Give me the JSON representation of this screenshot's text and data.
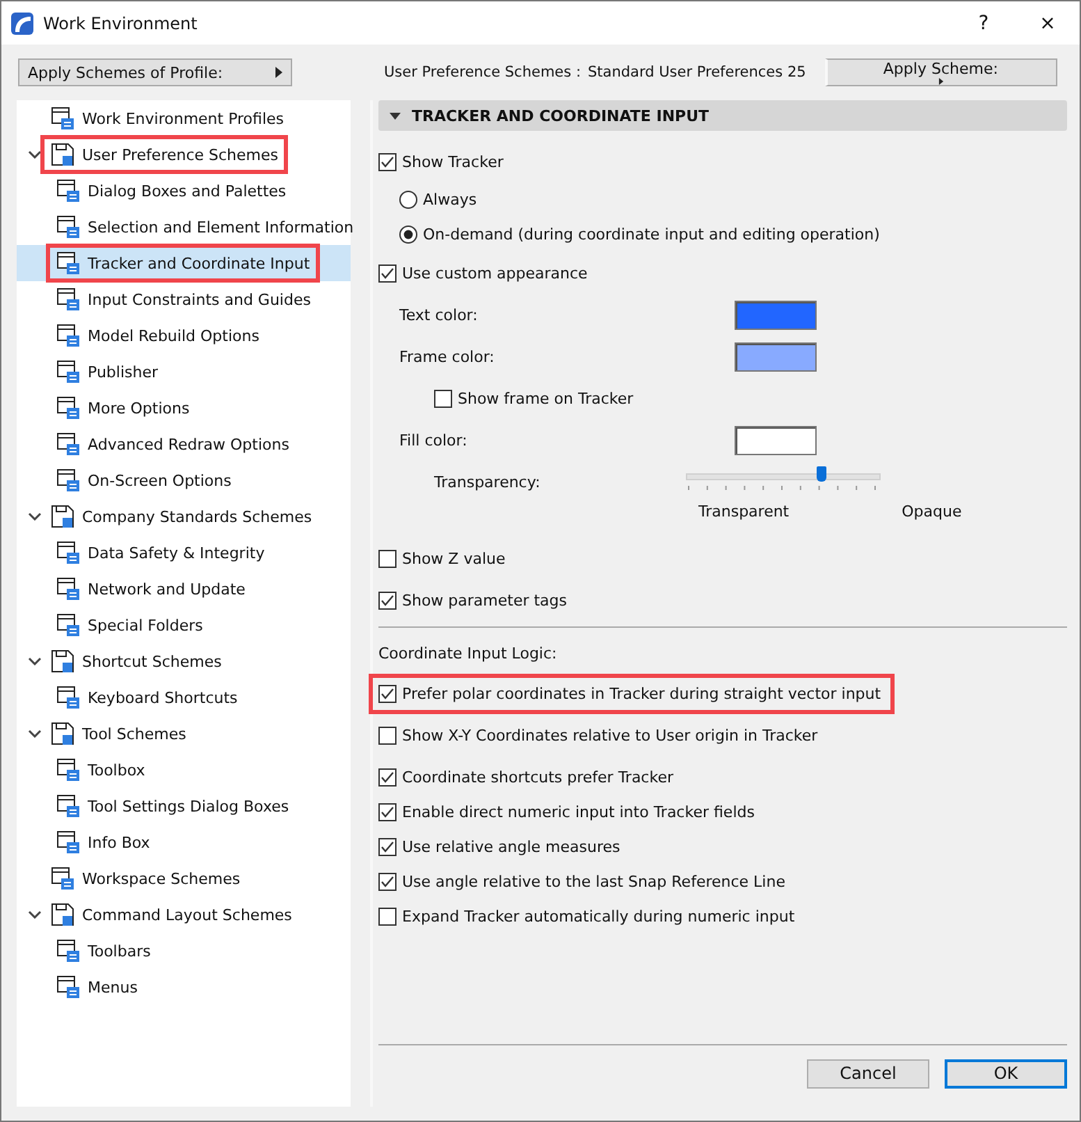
{
  "window": {
    "title": "Work Environment",
    "buttons": [
      "?",
      "×"
    ]
  },
  "profile_menu": {
    "label": "Apply Schemes of Profile:"
  },
  "scheme_info": {
    "label": "User Preference Schemes :",
    "value": "Standard User Preferences 25"
  },
  "apply_scheme_menu": {
    "label": "Apply Scheme:"
  },
  "tree": [
    {
      "label": "Work Environment Profiles",
      "selected": false,
      "annotated": false
    },
    {
      "label": "User Preference Schemes",
      "selected": false,
      "annotated": true,
      "expanded": true,
      "children": [
        {
          "label": "Dialog Boxes and Palettes",
          "selected": false,
          "annotated": false
        },
        {
          "label": "Selection and Element Information",
          "selected": false,
          "annotated": false
        },
        {
          "label": "Tracker and Coordinate Input",
          "selected": true,
          "annotated": true
        },
        {
          "label": "Input Constraints and Guides",
          "selected": false,
          "annotated": false
        },
        {
          "label": "Model Rebuild Options",
          "selected": false,
          "annotated": false
        },
        {
          "label": "Publisher",
          "selected": false,
          "annotated": false
        },
        {
          "label": "More Options",
          "selected": false,
          "annotated": false
        },
        {
          "label": "Advanced Redraw Options",
          "selected": false,
          "annotated": false
        },
        {
          "label": "On-Screen Options",
          "selected": false,
          "annotated": false
        }
      ]
    },
    {
      "label": "Company Standards Schemes",
      "selected": false,
      "annotated": false,
      "expanded": true,
      "children": [
        {
          "label": "Data Safety & Integrity",
          "selected": false,
          "annotated": false
        },
        {
          "label": "Network and Update",
          "selected": false,
          "annotated": false
        },
        {
          "label": "Special Folders",
          "selected": false,
          "annotated": false
        }
      ]
    },
    {
      "label": "Shortcut Schemes",
      "selected": false,
      "annotated": false,
      "expanded": true,
      "children": [
        {
          "label": "Keyboard Shortcuts",
          "selected": false,
          "annotated": false
        }
      ]
    },
    {
      "label": "Tool Schemes",
      "selected": false,
      "annotated": false,
      "expanded": true,
      "children": [
        {
          "label": "Toolbox",
          "selected": false,
          "annotated": false
        },
        {
          "label": "Tool Settings Dialog Boxes",
          "selected": false,
          "annotated": false
        },
        {
          "label": "Info Box",
          "selected": false,
          "annotated": false
        }
      ]
    },
    {
      "label": "Workspace Schemes",
      "selected": false,
      "annotated": false
    },
    {
      "label": "Command Layout Schemes",
      "selected": false,
      "annotated": false,
      "expanded": true,
      "children": [
        {
          "label": "Toolbars",
          "selected": false,
          "annotated": false
        },
        {
          "label": "Menus",
          "selected": false,
          "annotated": false
        }
      ]
    }
  ],
  "panel": {
    "title": "TRACKER AND COORDINATE INPUT",
    "expanded": true,
    "sections": [
      {
        "items": [
          {
            "kind": "checkbox",
            "label": "Show Tracker",
            "checked": true,
            "annotated": false,
            "children": [
              {
                "kind": "radio",
                "label": "Always",
                "selected": false
              },
              {
                "kind": "radio",
                "label": "On-demand (during coordinate input and editing operation)",
                "selected": true
              }
            ]
          },
          {
            "kind": "checkbox",
            "label": "Use custom appearance",
            "checked": true,
            "annotated": false,
            "children": [
              {
                "kind": "color",
                "label": "Text color:",
                "color": "#2266ff"
              },
              {
                "kind": "color",
                "label": "Frame color:",
                "color": "#88aaff",
                "children": [
                  {
                    "kind": "checkbox",
                    "label": "Show frame on Tracker",
                    "checked": false,
                    "annotated": false
                  }
                ]
              },
              {
                "kind": "color",
                "label": "Fill color:",
                "color": "#ffffff",
                "children": [
                  {
                    "kind": "slider",
                    "label": "Transparency:",
                    "level": 0.7,
                    "min_label": "Transparent",
                    "max_label": "Opaque"
                  }
                ]
              }
            ]
          },
          {
            "kind": "checkbox",
            "label": "Show Z value",
            "checked": false,
            "annotated": false
          },
          {
            "kind": "checkbox",
            "label": "Show parameter tags",
            "checked": true,
            "annotated": false
          }
        ]
      },
      {
        "heading": "Coordinate Input Logic:",
        "items": [
          {
            "kind": "checkbox",
            "label": "Prefer polar coordinates in Tracker during straight vector input",
            "checked": true,
            "annotated": true
          },
          {
            "kind": "checkbox",
            "label": "Show X-Y Coordinates relative to User origin in Tracker",
            "checked": false,
            "annotated": false
          }
        ]
      },
      {
        "items": [
          {
            "kind": "checkbox",
            "label": "Coordinate shortcuts prefer Tracker",
            "checked": true,
            "annotated": false
          },
          {
            "kind": "checkbox",
            "label": "Enable direct numeric input into Tracker fields",
            "checked": true,
            "annotated": false
          },
          {
            "kind": "checkbox",
            "label": "Use relative angle measures",
            "checked": true,
            "annotated": false
          },
          {
            "kind": "checkbox",
            "label": "Use angle relative to the last Snap Reference Line",
            "checked": true,
            "annotated": false
          },
          {
            "kind": "checkbox",
            "label": "Expand Tracker automatically during numeric input",
            "checked": false,
            "annotated": false
          }
        ]
      }
    ]
  },
  "buttons": [
    {
      "label": "Cancel",
      "default": false
    },
    {
      "label": "OK",
      "default": true
    }
  ]
}
